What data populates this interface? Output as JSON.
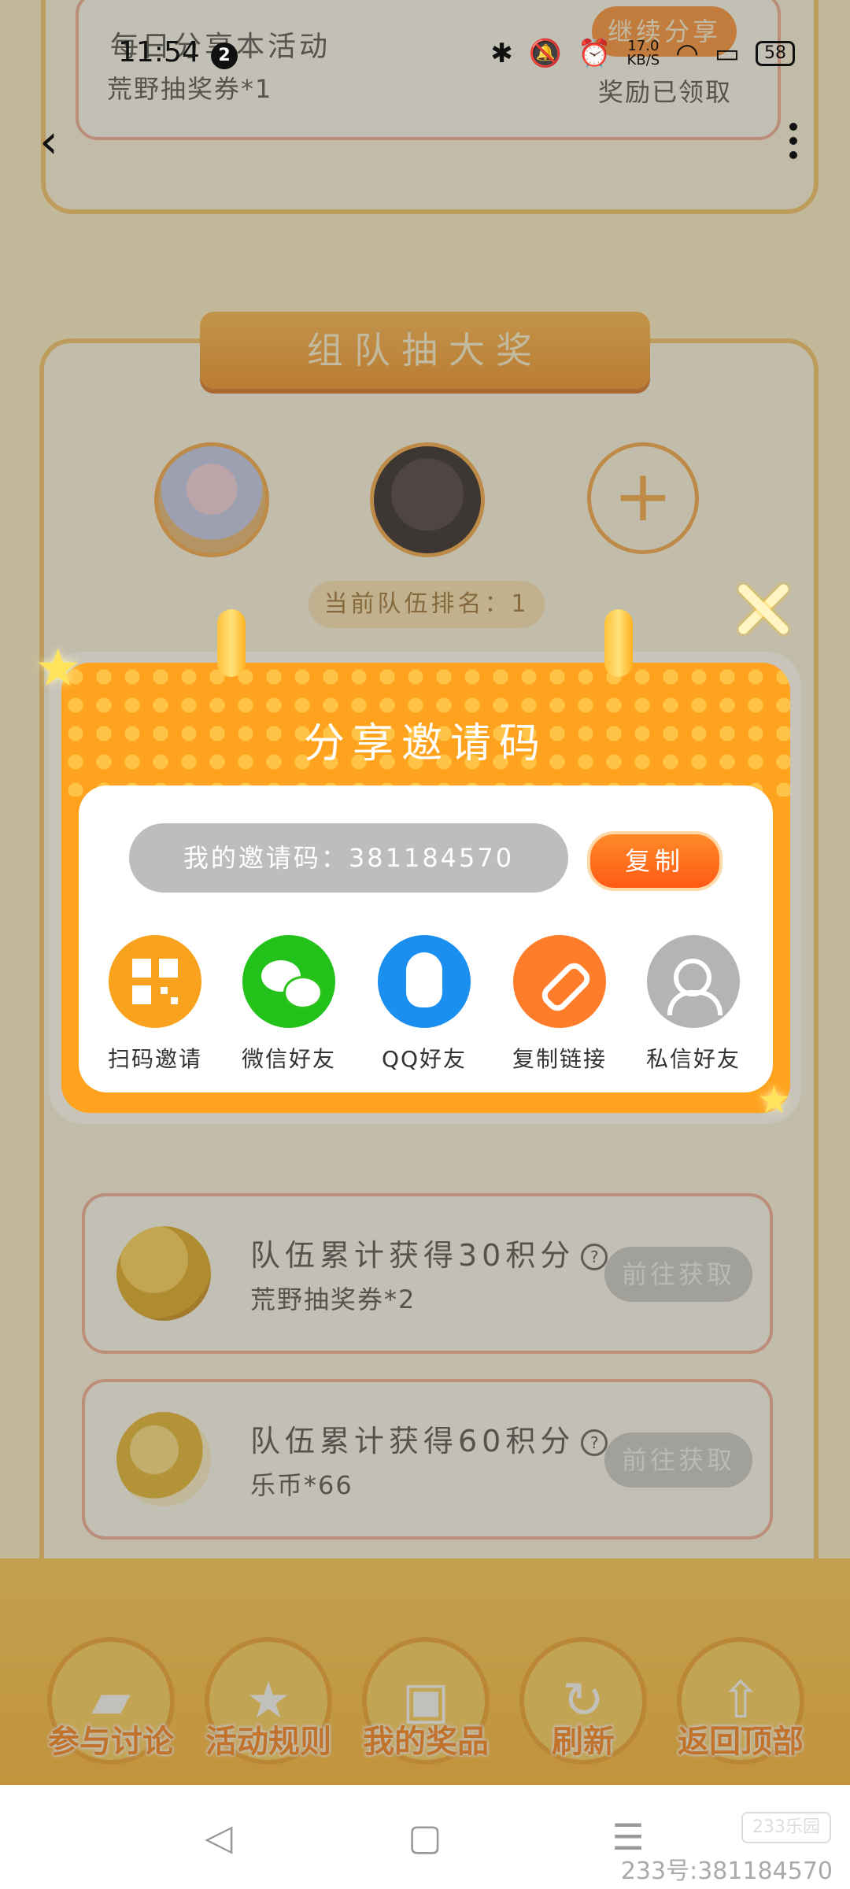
{
  "status_bar": {
    "time": "11:54",
    "notification_count": "2",
    "net_speed_value": "17.0",
    "net_speed_unit": "KB/S",
    "battery": "58"
  },
  "background": {
    "share_task_title": "每日分享本活动",
    "share_task_reward": "荒野抽奖券*1",
    "continue_share_button": "继续分享",
    "reward_claimed": "奖励已领取",
    "team_banner": "组队抽大奖",
    "team_rank": "当前队伍排名：1",
    "tasks": [
      {
        "title": "队伍累计获得30积分",
        "reward": "荒野抽奖券*2",
        "button": "前往获取"
      },
      {
        "title": "队伍累计获得60积分",
        "reward": "乐币*66",
        "button": "前往获取"
      }
    ],
    "bottom_nav": [
      {
        "label": "参与讨论",
        "icon": "chat-icon"
      },
      {
        "label": "活动规则",
        "icon": "star-icon"
      },
      {
        "label": "我的奖品",
        "icon": "gift-icon"
      },
      {
        "label": "刷新",
        "icon": "refresh-icon"
      },
      {
        "label": "返回顶部",
        "icon": "upload-icon"
      }
    ]
  },
  "modal": {
    "title": "分享邀请码",
    "invite_code_text": "我的邀请码：381184570",
    "copy_button": "复制",
    "share_options": [
      {
        "label": "扫码邀请",
        "icon": "qr-code-icon",
        "color": "#f9a21d"
      },
      {
        "label": "微信好友",
        "icon": "wechat-icon",
        "color": "#23c21b"
      },
      {
        "label": "QQ好友",
        "icon": "qq-icon",
        "color": "#1b8ff0"
      },
      {
        "label": "复制链接",
        "icon": "link-icon",
        "color": "#ff7d2a"
      },
      {
        "label": "私信好友",
        "icon": "friends-icon",
        "color": "#b4b4b4"
      }
    ]
  },
  "watermark": {
    "logo": "233乐园",
    "text": "233号:381184570"
  },
  "colors": {
    "modal_orange": "#ffa31f",
    "copy_button": "#ff6a1f",
    "page_bg": "#fff3c8"
  }
}
